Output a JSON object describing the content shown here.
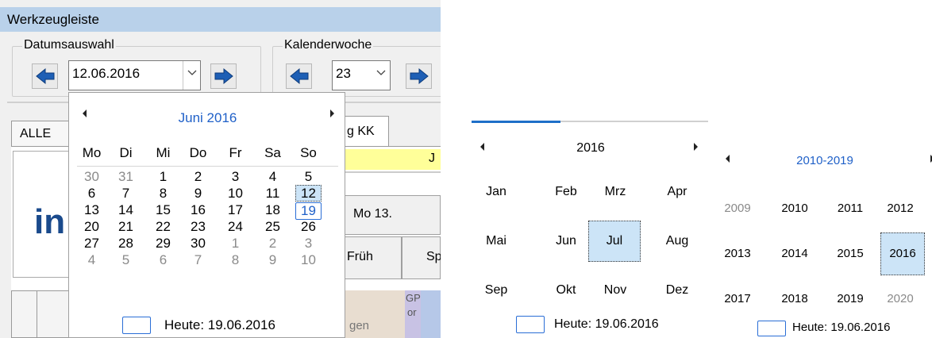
{
  "left_window": {
    "toolbar_title": "Werkzeugleiste",
    "date_group_label": "Datumsauswahl",
    "date_value": "12.06.2016",
    "week_group_label": "Kalenderwoche",
    "week_value": "23",
    "tab_all": "ALLE",
    "tab_kk": "g KK",
    "band_letter": "J",
    "logo_text": "in",
    "col_mo13": "Mo 13.",
    "col_frueh": "Früh",
    "col_sp": "Sp",
    "cell_gen": "gen",
    "cell_gp": "GP",
    "cell_or": "or"
  },
  "month_popup": {
    "title": "Juni 2016",
    "weekdays": [
      "Mo",
      "Di",
      "Mi",
      "Do",
      "Fr",
      "Sa",
      "So"
    ],
    "weeks": [
      [
        "30",
        "31",
        "1",
        "2",
        "3",
        "4",
        "5"
      ],
      [
        "6",
        "7",
        "8",
        "9",
        "10",
        "11",
        "12"
      ],
      [
        "13",
        "14",
        "15",
        "16",
        "17",
        "18",
        "19"
      ],
      [
        "20",
        "21",
        "22",
        "23",
        "24",
        "25",
        "26"
      ],
      [
        "27",
        "28",
        "29",
        "30",
        "1",
        "2",
        "3"
      ],
      [
        "4",
        "5",
        "6",
        "7",
        "8",
        "9",
        "10"
      ]
    ],
    "selected_day": "12",
    "today_day": "19",
    "today_label": "Heute: 19.06.2016"
  },
  "year_popup": {
    "title": "2016",
    "months": [
      [
        "Jan",
        "Feb",
        "Mrz",
        "Apr"
      ],
      [
        "Mai",
        "Jun",
        "Jul",
        "Aug"
      ],
      [
        "Sep",
        "Okt",
        "Nov",
        "Dez"
      ]
    ],
    "selected_month": "Jul",
    "today_label": "Heute: 19.06.2016"
  },
  "decade_popup": {
    "title": "2010-2019",
    "years": [
      [
        "2009",
        "2010",
        "2011",
        "2012"
      ],
      [
        "2013",
        "2014",
        "2015",
        "2016"
      ],
      [
        "2017",
        "2018",
        "2019",
        "2020"
      ]
    ],
    "selected_year": "2016",
    "today_label": "Heute: 19.06.2016"
  },
  "colors": {
    "title_bar": "#b9d1ea",
    "selection_bg": "#cce4f7",
    "today_border": "#2a6ed6",
    "header_blue": "#1f60c8",
    "yellow_band": "#ffff99"
  }
}
